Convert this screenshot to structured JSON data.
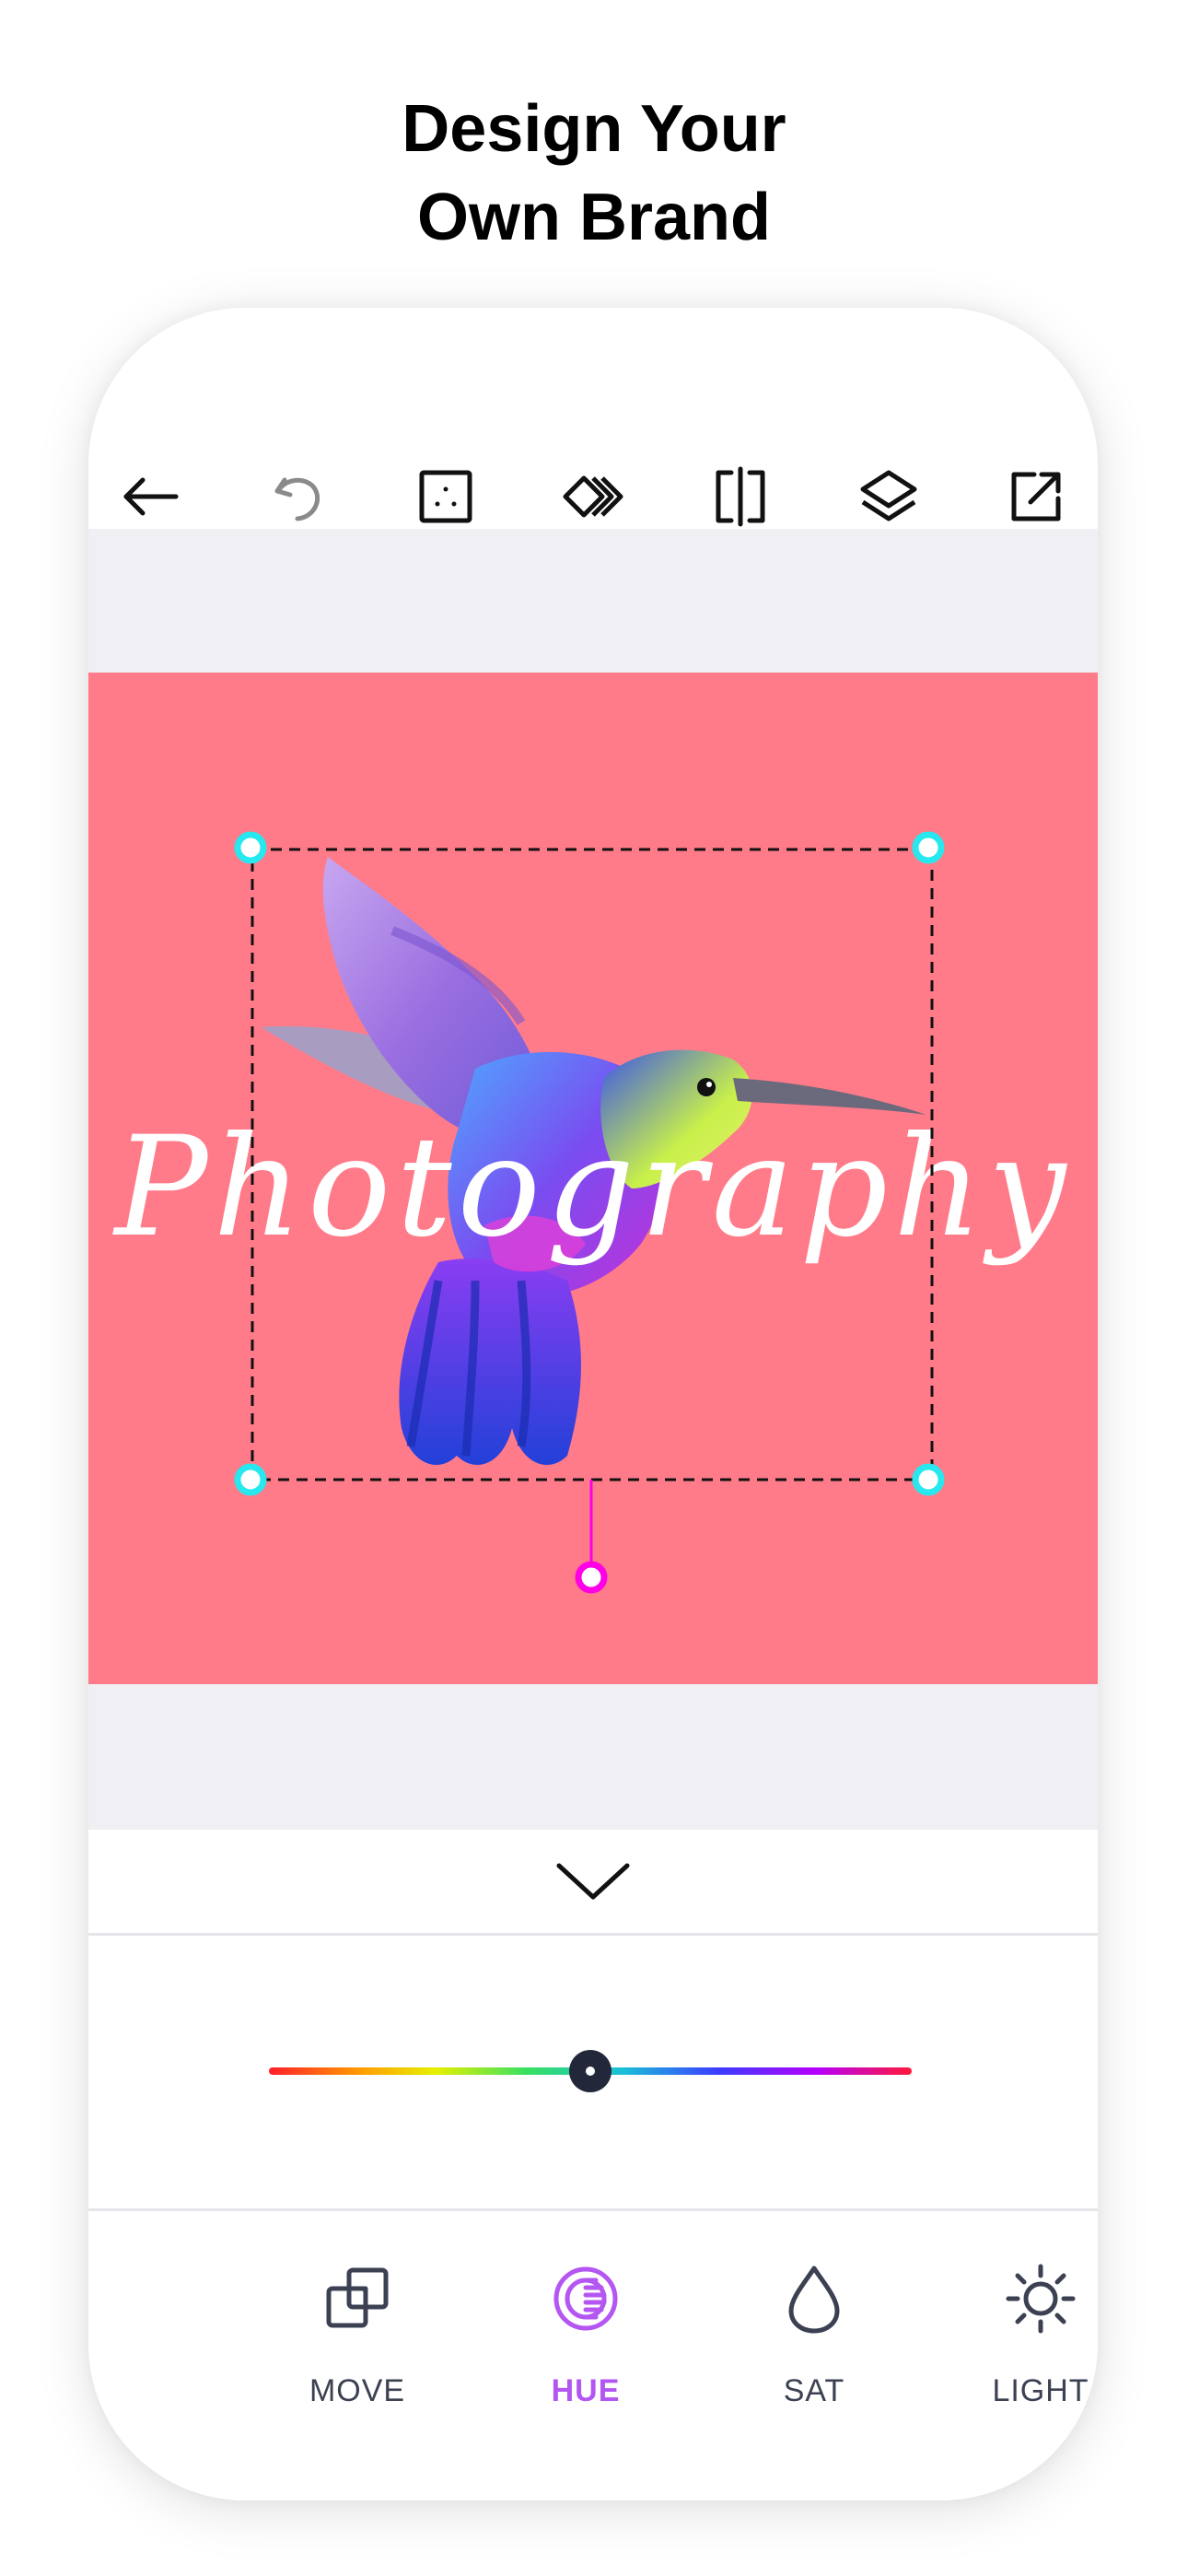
{
  "headline": {
    "line1": "Design Your",
    "line2": "Own Brand"
  },
  "toolbar": {
    "items": [
      {
        "name": "back",
        "icon": "arrow-left-icon"
      },
      {
        "name": "undo",
        "icon": "undo-icon"
      },
      {
        "name": "canvas-size",
        "icon": "dotted-square-icon"
      },
      {
        "name": "arrange",
        "icon": "diamond-layers-icon"
      },
      {
        "name": "flip",
        "icon": "flip-horizontal-icon"
      },
      {
        "name": "layers",
        "icon": "layers-icon"
      },
      {
        "name": "export",
        "icon": "export-icon"
      }
    ]
  },
  "canvas": {
    "background_color": "#ff7b89",
    "text_layer": "Photography",
    "selection_handle_color": "#27e8ee",
    "rotate_handle_color": "#ff00e6"
  },
  "panel": {
    "collapse_icon": "chevron-down-icon",
    "hue_slider": {
      "value": 0.5,
      "thumb_color": "#22283a"
    }
  },
  "tabs": [
    {
      "label": "MOVE",
      "icon": "move-layers-icon",
      "active": false
    },
    {
      "label": "HUE",
      "icon": "hue-icon",
      "active": true
    },
    {
      "label": "SAT",
      "icon": "drop-icon",
      "active": false
    },
    {
      "label": "LIGHT",
      "icon": "sun-icon",
      "active": false
    }
  ],
  "colors": {
    "accent": "#b456f2",
    "tab_text": "#3b4152"
  }
}
